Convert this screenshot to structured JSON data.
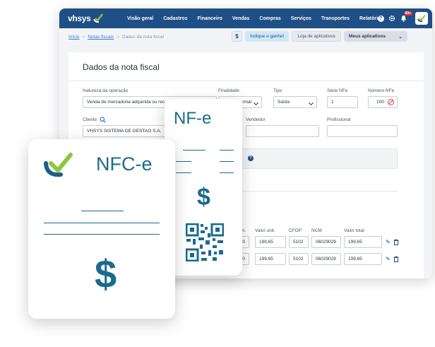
{
  "nav": {
    "brand": "vhsys",
    "items": [
      "Visão geral",
      "Cadastros",
      "Financeiro",
      "Vendas",
      "Compras",
      "Serviços",
      "Transportes",
      "Relatórios"
    ],
    "notification_count": "99+",
    "icons": [
      "help-icon",
      "gear-icon",
      "bell-icon",
      "user-avatar"
    ]
  },
  "breadcrumb": [
    "Início",
    "Notas fiscais",
    "Dados da nota fiscal"
  ],
  "actions": {
    "dollar": "$",
    "refer": "Indique e ganhe!",
    "store": "Loja de aplicativos",
    "apps": "Meus aplicativos"
  },
  "form": {
    "title": "Dados da nota fiscal",
    "natureza_label": "Natureza da operação",
    "natureza_value": "Venda de mercadoria adquirida ou rec",
    "finalidade_label": "Finalidade",
    "finalidade_value": "rmal",
    "tipo_label": "Tipo",
    "tipo_value": "Saída",
    "serie_label": "Série NFe",
    "serie_value": "1",
    "numero_label": "Número NFe",
    "numero_value": "100",
    "cliente_label": "Cliente",
    "cliente_value": "VHSYS SISTEMA DE GESTAO S.A.",
    "vendedor_label": "Vendedor",
    "profissional_label": "Profissional",
    "grey_text": "l"
  },
  "items_table": {
    "headers": [
      "%",
      "Valor unit.",
      "CFOP",
      "NCM",
      "Valor total"
    ],
    "rows": [
      {
        "pct": "0",
        "unit": "199,65",
        "cfop": "5102",
        "ncm": "06029029",
        "total": "199,65"
      },
      {
        "pct": "0",
        "unit": "199,65",
        "cfop": "5102",
        "ncm": "06029029",
        "total": "199,65"
      }
    ]
  },
  "cards": {
    "nfe_title": "NF-e",
    "nfce_title": "NFC-e",
    "dollar": "$"
  },
  "colors": {
    "nav_bg": "#1e4f86",
    "accent_green": "#8cc63f",
    "doc_teal": "#1b6b8d",
    "danger": "#e53935"
  }
}
